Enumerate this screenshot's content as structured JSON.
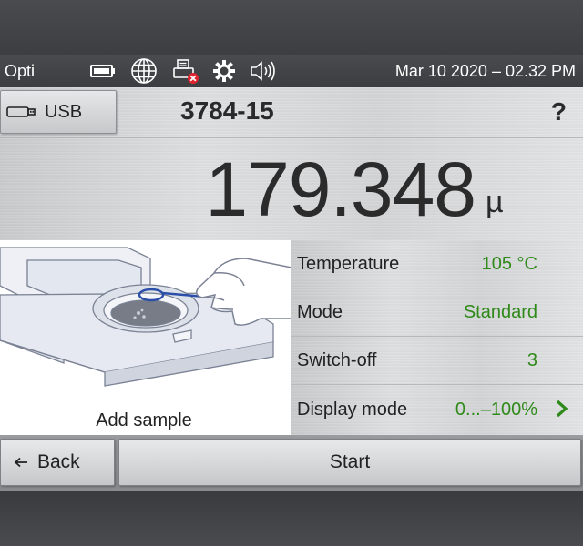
{
  "statusbar": {
    "brand": "Opti",
    "datetime": "Mar 10 2020 – 02.32 PM",
    "icons": [
      "battery-icon",
      "globe-icon",
      "printer-error-icon",
      "settings-gear-icon",
      "speaker-icon"
    ]
  },
  "header": {
    "usb_label": "USB",
    "sample_id": "3784-15",
    "help_label": "?"
  },
  "result": {
    "value": "179.348",
    "unit": "µ"
  },
  "illustration": {
    "caption": "Add sample"
  },
  "parameters": [
    {
      "name": "Temperature",
      "value": "105 °C"
    },
    {
      "name": "Mode",
      "value": "Standard"
    },
    {
      "name": "Switch-off",
      "value": "3"
    },
    {
      "name": "Display mode",
      "value": "0...–100%"
    }
  ],
  "buttons": {
    "back_label": "Back",
    "start_label": "Start"
  },
  "colors": {
    "value_green": "#2f8a1a",
    "status_bar": "#3f4043",
    "arrow_green": "#2f8a1a"
  }
}
